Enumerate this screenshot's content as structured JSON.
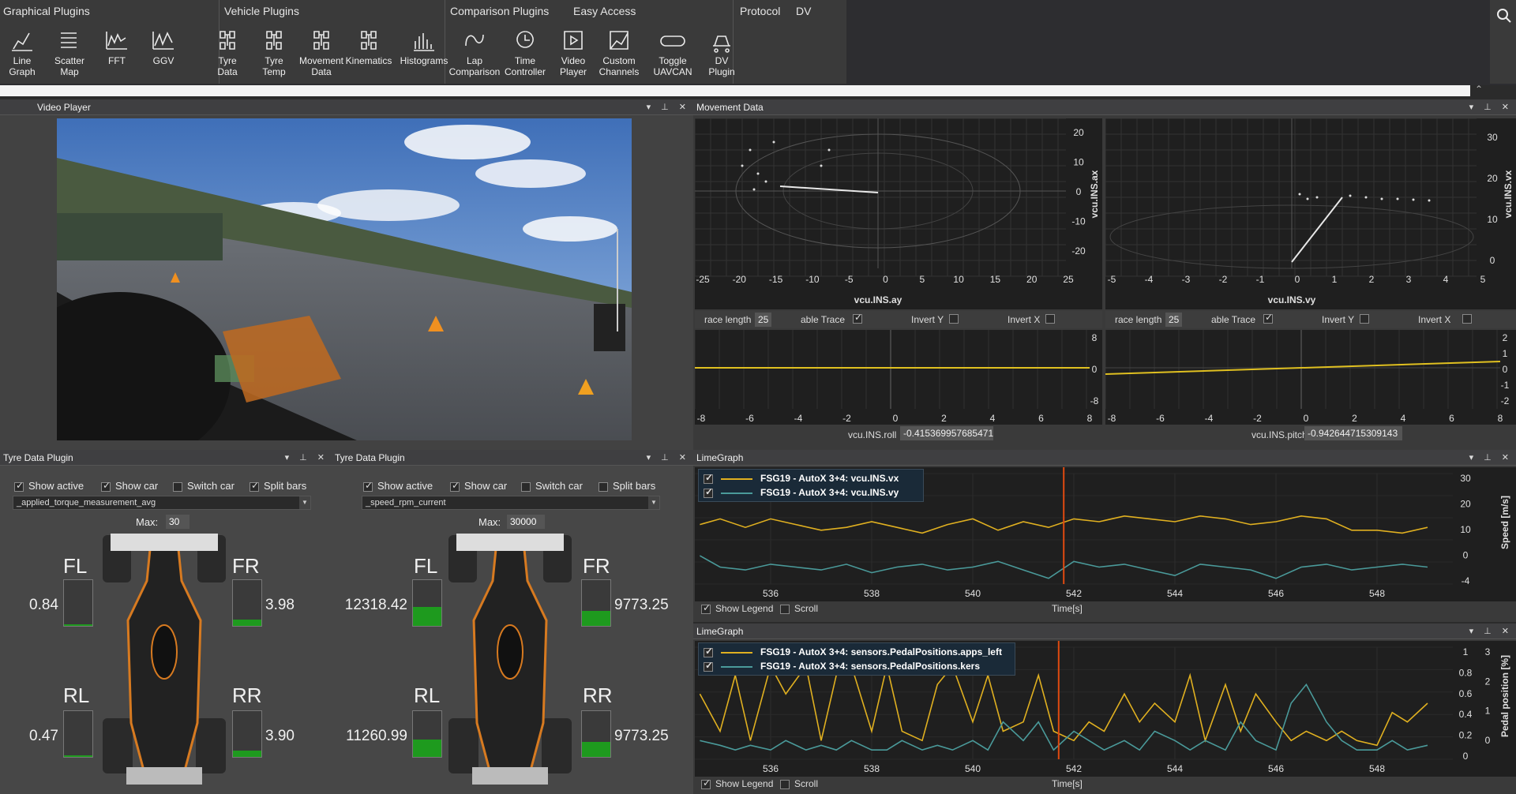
{
  "ribbon": {
    "groups": [
      "Graphical Plugins",
      "Vehicle Plugins",
      "Comparison Plugins",
      "Easy Access",
      "Protocol",
      "DV"
    ],
    "tools": [
      {
        "label1": "Line",
        "label2": "Graph",
        "icon": "line-graph-icon"
      },
      {
        "label1": "Scatter",
        "label2": "Map",
        "icon": "scatter-map-icon"
      },
      {
        "label1": "FFT",
        "label2": "",
        "icon": "fft-icon"
      },
      {
        "label1": "GGV",
        "label2": "",
        "icon": "ggv-icon"
      },
      {
        "label1": "Tyre",
        "label2": "Data",
        "icon": "tyre-data-icon"
      },
      {
        "label1": "Tyre",
        "label2": "Temp",
        "icon": "tyre-temp-icon"
      },
      {
        "label1": "Movement",
        "label2": "Data",
        "icon": "movement-data-icon"
      },
      {
        "label1": "Kinematics",
        "label2": "",
        "icon": "kinematics-icon"
      },
      {
        "label1": "Histograms",
        "label2": "",
        "icon": "histograms-icon"
      },
      {
        "label1": "Lap",
        "label2": "Comparison",
        "icon": "lap-comparison-icon"
      },
      {
        "label1": "Time",
        "label2": "Controller",
        "icon": "time-controller-icon"
      },
      {
        "label1": "Video",
        "label2": "Player",
        "icon": "video-player-icon"
      },
      {
        "label1": "Custom",
        "label2": "Channels",
        "icon": "custom-channels-icon"
      },
      {
        "label1": "Toggle",
        "label2": "UAVCAN",
        "icon": "toggle-uavcan-icon"
      },
      {
        "label1": "DV",
        "label2": "Plugin",
        "icon": "dv-plugin-icon"
      }
    ]
  },
  "video_panel": {
    "title": "Video Player"
  },
  "tyre_panels": [
    {
      "title": "Tyre Data Plugin",
      "opts": {
        "show_active": "Show active",
        "show_car": "Show car",
        "switch_car": "Switch car",
        "split_bars": "Split bars"
      },
      "channel": "_applied_torque_measurement_avg",
      "max_label": "Max:",
      "max_value": "30",
      "wheels": {
        "FL": "FL",
        "FR": "FR",
        "RL": "RL",
        "RR": "RR"
      },
      "values": {
        "FL": "0.84",
        "FR": "3.98",
        "RL": "0.47",
        "RR": "3.90"
      },
      "fill": {
        "FL": 0.03,
        "FR": 0.13,
        "RL": 0.02,
        "RR": 0.13
      }
    },
    {
      "title": "Tyre Data Plugin",
      "opts": {
        "show_active": "Show active",
        "show_car": "Show car",
        "switch_car": "Switch car",
        "split_bars": "Split bars"
      },
      "channel": "_speed_rpm_current",
      "max_label": "Max:",
      "max_value": "30000",
      "wheels": {
        "FL": "FL",
        "FR": "FR",
        "RL": "RL",
        "RR": "RR"
      },
      "values": {
        "FL": "12318.42",
        "FR": "9773.25",
        "RL": "11260.99",
        "RR": "9773.25"
      },
      "fill": {
        "FL": 0.41,
        "FR": 0.33,
        "RL": 0.38,
        "RR": 0.33
      }
    }
  ],
  "movement_panel": {
    "title": "Movement Data",
    "left": {
      "xlabel": "vcu.INS.ay",
      "ylabel": "vcu.INS.ax",
      "xticks": [
        "-25",
        "-20",
        "-15",
        "-10",
        "-5",
        "0",
        "5",
        "10",
        "15",
        "20",
        "25"
      ],
      "yticks": [
        "20",
        "10",
        "0",
        "-10",
        "-20"
      ],
      "trace_length_label": "race length",
      "trace_length": "25",
      "enable_trace": "able Trace",
      "invert_y": "Invert Y",
      "invert_x": "Invert X",
      "bottom_xticks": [
        "-8",
        "-6",
        "-4",
        "-2",
        "0",
        "2",
        "4",
        "6",
        "8"
      ],
      "bottom_yticks": [
        "8",
        "0",
        "-8"
      ],
      "bottom_label": "vcu.INS.roll",
      "bottom_value": "-0.415369957685471"
    },
    "right": {
      "xlabel": "vcu.INS.vy",
      "ylabel": "vcu.INS.vx",
      "xticks": [
        "-5",
        "-4",
        "-3",
        "-2",
        "-1",
        "0",
        "1",
        "2",
        "3",
        "4",
        "5"
      ],
      "yticks": [
        "30",
        "20",
        "10",
        "0"
      ],
      "trace_length_label": "race length",
      "trace_length": "25",
      "enable_trace": "able Trace",
      "invert_y": "Invert Y",
      "invert_x": "Invert X",
      "bottom_xticks": [
        "-8",
        "-6",
        "-4",
        "-2",
        "0",
        "2",
        "4",
        "6",
        "8"
      ],
      "bottom_yticks": [
        "2",
        "1",
        "0",
        "-1",
        "-2"
      ],
      "bottom_label": "vcu.INS.pitch",
      "bottom_value": "-0.942644715309143"
    }
  },
  "linegraphs": [
    {
      "title": "LimeGraph",
      "legend": [
        {
          "label": "FSG19 - AutoX 3+4: vcu.INS.vx",
          "color": "#e0b020"
        },
        {
          "label": "FSG19 - AutoX 3+4: vcu.INS.vy",
          "color": "#4a9a9a"
        }
      ],
      "xticks": [
        "536",
        "538",
        "540",
        "542",
        "544",
        "546",
        "548"
      ],
      "yticks": [
        "30",
        "20",
        "10",
        "0",
        "-4"
      ],
      "ylabel": "Speed [m/s]",
      "xlabel": "Time[s]",
      "show_legend": "Show Legend",
      "scroll": "Scroll"
    },
    {
      "title": "LimeGraph",
      "legend": [
        {
          "label": "FSG19 - AutoX 3+4: sensors.PedalPositions.apps_left",
          "color": "#e0b020"
        },
        {
          "label": "FSG19 - AutoX 3+4: sensors.PedalPositions.kers",
          "color": "#4a9a9a"
        }
      ],
      "xticks": [
        "536",
        "538",
        "540",
        "542",
        "544",
        "546",
        "548"
      ],
      "yticks_left": [
        "1",
        "0.8",
        "0.6",
        "0.4",
        "0.2",
        "0"
      ],
      "yticks_right": [
        "3",
        "2",
        "1",
        "0"
      ],
      "ylabel": "Pedal position [%]",
      "xlabel": "Time[s]",
      "show_legend": "Show Legend",
      "scroll": "Scroll"
    }
  ],
  "chart_data": [
    {
      "type": "line",
      "title": "",
      "xlabel": "Time[s]",
      "ylabel": "Speed [m/s]",
      "xlim": [
        534.5,
        549.5
      ],
      "ylim": [
        -6,
        33
      ],
      "cursor_x": 541.8,
      "series": [
        {
          "name": "FSG19 - AutoX 3+4: vcu.INS.vx",
          "color": "#e0b020",
          "x": [
            534.6,
            535,
            535.5,
            536,
            536.5,
            537,
            537.5,
            538,
            538.5,
            539,
            539.5,
            540,
            540.5,
            541,
            541.5,
            542,
            542.5,
            543,
            543.5,
            544,
            544.5,
            545,
            545.5,
            546,
            546.5,
            547,
            547.5,
            548,
            548.5,
            549
          ],
          "y": [
            15,
            17,
            14,
            17,
            15,
            13,
            14,
            16,
            14,
            12,
            15,
            17,
            13,
            16,
            14,
            17,
            16,
            18,
            17,
            16,
            18,
            17,
            15,
            16,
            18,
            17,
            13,
            13,
            12,
            14
          ]
        },
        {
          "name": "FSG19 - AutoX 3+4: vcu.INS.vy",
          "color": "#4a9a9a",
          "x": [
            534.6,
            535,
            535.5,
            536,
            536.5,
            537,
            537.5,
            538,
            538.5,
            539,
            539.5,
            540,
            540.5,
            541,
            541.5,
            542,
            542.5,
            543,
            543.5,
            544,
            544.5,
            545,
            545.5,
            546,
            546.5,
            547,
            547.5,
            548,
            548.5,
            549
          ],
          "y": [
            4,
            0,
            -1,
            1,
            0,
            -1,
            1,
            -2,
            0,
            1,
            -1,
            0,
            2,
            -1,
            -4,
            2,
            0,
            1,
            -1,
            -3,
            1,
            0,
            -1,
            -4,
            0,
            1,
            -1,
            0,
            1,
            0
          ]
        }
      ]
    },
    {
      "type": "line",
      "title": "",
      "xlabel": "Time[s]",
      "ylabel": "Pedal position [%]",
      "xlim": [
        534.5,
        549.5
      ],
      "ylim": [
        -0.1,
        1.1
      ],
      "cursor_x": 541.7,
      "series": [
        {
          "name": "FSG19 - AutoX 3+4: sensors.PedalPositions.apps_left",
          "color": "#e0b020",
          "x": [
            534.6,
            535,
            535.3,
            535.6,
            536,
            536.3,
            536.7,
            537,
            537.3,
            537.6,
            538,
            538.3,
            538.6,
            539,
            539.3,
            539.6,
            540,
            540.3,
            540.6,
            541,
            541.3,
            541.6,
            542,
            542.3,
            542.6,
            543,
            543.3,
            543.6,
            544,
            544.3,
            544.6,
            545,
            545.3,
            545.6,
            546,
            546.3,
            546.6,
            547,
            547.3,
            547.6,
            548,
            548.3,
            548.6,
            549
          ],
          "y": [
            0.6,
            0.2,
            0.8,
            0.1,
            0.9,
            0.6,
            0.9,
            0.1,
            0.8,
            0.9,
            0.2,
            0.9,
            0.2,
            0.1,
            0.7,
            0.9,
            0.3,
            0.8,
            0.2,
            0.3,
            0.8,
            0.2,
            0.1,
            0.3,
            0.2,
            0.6,
            0.3,
            0.5,
            0.3,
            0.8,
            0.1,
            0.7,
            0.2,
            0.6,
            0.3,
            0.1,
            0.2,
            0.1,
            0.2,
            0.1,
            0.05,
            0.4,
            0.3,
            0.5
          ]
        },
        {
          "name": "FSG19 - AutoX 3+4: sensors.PedalPositions.kers",
          "color": "#4a9a9a",
          "x": [
            534.6,
            535,
            535.3,
            535.6,
            536,
            536.3,
            536.7,
            537,
            537.3,
            537.6,
            538,
            538.3,
            538.6,
            539,
            539.3,
            539.6,
            540,
            540.3,
            540.6,
            541,
            541.3,
            541.6,
            542,
            542.3,
            542.6,
            543,
            543.3,
            543.6,
            544,
            544.3,
            544.6,
            545,
            545.3,
            545.6,
            546,
            546.3,
            546.6,
            547,
            547.3,
            547.6,
            548,
            548.3,
            548.6,
            549
          ],
          "y": [
            0.1,
            0.05,
            0.0,
            0.05,
            0.0,
            0.1,
            0.0,
            0.05,
            0.0,
            0.1,
            0.0,
            0.0,
            0.1,
            0.0,
            0.05,
            0.0,
            0.1,
            0.0,
            0.3,
            0.1,
            0.3,
            0.0,
            0.2,
            0.1,
            0.0,
            0.1,
            0.0,
            0.2,
            0.1,
            0.0,
            0.1,
            0.0,
            0.3,
            0.1,
            0.0,
            0.5,
            0.7,
            0.3,
            0.1,
            0.0,
            0.0,
            0.1,
            0.0,
            0.05
          ]
        }
      ]
    }
  ]
}
